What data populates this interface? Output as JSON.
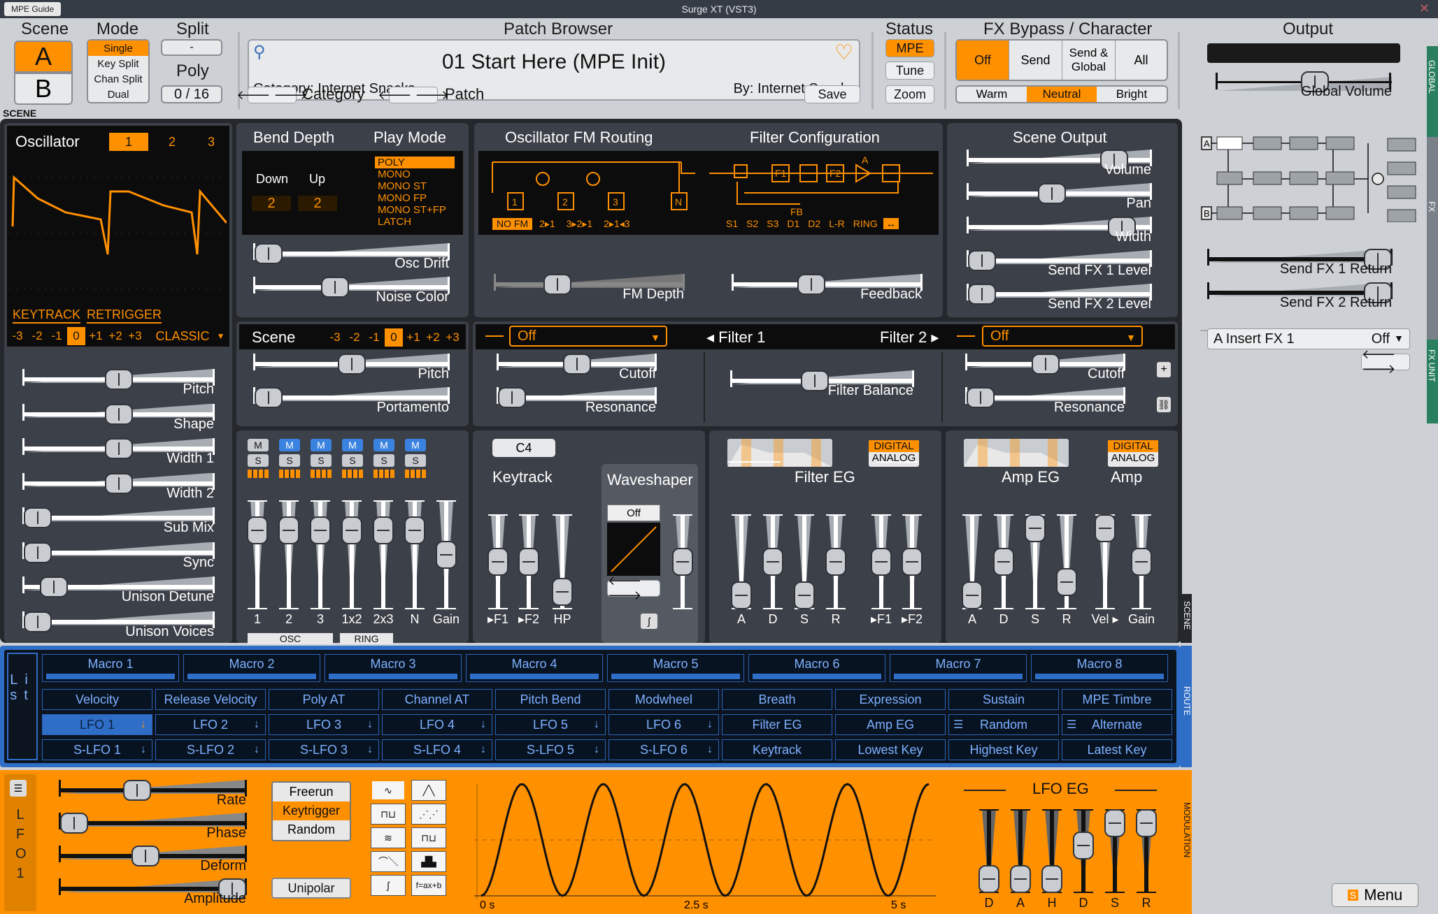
{
  "window": {
    "title": "Surge XT (VST3)",
    "guide_label": "MPE Guide"
  },
  "header": {
    "scene": {
      "label": "Scene",
      "a": "A",
      "b": "B"
    },
    "mode": {
      "label": "Mode",
      "options": [
        "Single",
        "Key Split",
        "Chan Split",
        "Dual"
      ],
      "selected": "Single"
    },
    "split": {
      "label": "Split",
      "value": "-",
      "poly_label": "Poly",
      "poly_value": "0 / 16"
    },
    "patch": {
      "label": "Patch Browser",
      "name": "01 Start Here (MPE Init)",
      "category": "Category: Internet Snacks",
      "author": "By: Internet Snacks",
      "category_label": "Category",
      "patch_label": "Patch",
      "save": "Save"
    },
    "status": {
      "label": "Status",
      "mpe": "MPE",
      "tune": "Tune",
      "zoom": "Zoom"
    },
    "fx": {
      "label": "FX Bypass / Character",
      "off": "Off",
      "send": "Send",
      "send_global": "Send & Global",
      "all": "All",
      "warm": "Warm",
      "neutral": "Neutral",
      "bright": "Bright"
    },
    "output": {
      "label": "Output",
      "global_volume": "Global Volume"
    }
  },
  "scene_tag": "SCENE",
  "oscillator": {
    "title": "Oscillator",
    "tabs": [
      "1",
      "2",
      "3"
    ],
    "keytrack": "KEYTRACK",
    "retrigger": "RETRIGGER",
    "octaves": [
      "-3",
      "-2",
      "-1",
      "0",
      "+1",
      "+2",
      "+3"
    ],
    "type": "CLASSIC",
    "params": [
      "Pitch",
      "Shape",
      "Width 1",
      "Width 2",
      "Sub Mix",
      "Sync",
      "Unison Detune",
      "Unison Voices"
    ],
    "param_levels": [
      0.5,
      0.5,
      0.5,
      0.5,
      0.0,
      0.0,
      0.1,
      0.0
    ]
  },
  "bend": {
    "title": "Bend Depth",
    "down_label": "Down",
    "up_label": "Up",
    "down": "2",
    "up": "2"
  },
  "playmode": {
    "title": "Play Mode",
    "options": [
      "POLY",
      "MONO",
      "MONO ST",
      "MONO FP",
      "MONO ST+FP",
      "LATCH"
    ],
    "selected": "POLY"
  },
  "drift": {
    "osc_drift": "Osc Drift",
    "noise_color": "Noise Color"
  },
  "fm": {
    "title": "Oscillator FM Routing",
    "modes": [
      "NO FM",
      "2▸1",
      "3▸2▸1",
      "2▸1◂3"
    ],
    "depth": "FM Depth",
    "labels": [
      "1",
      "2",
      "3",
      "N"
    ]
  },
  "filtercfg": {
    "title": "Filter Configuration",
    "modes": [
      "S1",
      "S2",
      "S3",
      "D1",
      "D2",
      "L-R",
      "RING",
      "↔"
    ],
    "feedback": "Feedback",
    "fb": "FB",
    "a": "A",
    "f1": "F1",
    "f2": "F2"
  },
  "sceneout": {
    "title": "Scene Output",
    "params": [
      "Volume",
      "Pan",
      "Width",
      "Send FX 1 Level",
      "Send FX 2 Level"
    ]
  },
  "scene2": {
    "title": "Scene",
    "octaves": [
      "-3",
      "-2",
      "-1",
      "0",
      "+1",
      "+2",
      "+3"
    ],
    "pitch": "Pitch",
    "portamento": "Portamento"
  },
  "filters": {
    "f1_type": "Off",
    "f1_label": "◂ Filter 1",
    "f2_label": "Filter 2 ▸",
    "f2_type": "Off",
    "cutoff": "Cutoff",
    "resonance": "Resonance",
    "balance": "Filter Balance"
  },
  "mixer": {
    "m": "M",
    "s": "S",
    "channels": [
      "1",
      "2",
      "3",
      "1x2",
      "2x3",
      "N",
      "Gain"
    ],
    "osc": "OSC",
    "ring": "RING",
    "mute_active": [
      false,
      true,
      true,
      true,
      true,
      true
    ]
  },
  "keytrack": {
    "note": "C4",
    "title": "Keytrack",
    "labels": [
      "▸F1",
      "▸F2",
      "HP"
    ],
    "waveshaper": "Waveshaper",
    "ws_type": "Off"
  },
  "filtereg": {
    "title": "Filter EG",
    "digital": "DIGITAL",
    "analog": "ANALOG",
    "labels": [
      "A",
      "D",
      "S",
      "R",
      "▸F1",
      "▸F2"
    ]
  },
  "ampeg": {
    "title": "Amp EG",
    "amp": "Amp",
    "digital": "DIGITAL",
    "analog": "ANALOG",
    "labels": [
      "A",
      "D",
      "S",
      "R",
      "Vel ▸",
      "Gain"
    ]
  },
  "global_side": {
    "tag_global": "GLOBAL",
    "tag_fx": "FX",
    "tag_fxunit": "FX UNIT",
    "send1": "Send FX 1 Return",
    "send2": "Send FX 2 Return",
    "insert_label": "A Insert FX 1",
    "insert_value": "Off",
    "a": "A",
    "b": "B"
  },
  "routing": {
    "list": "List",
    "macros": [
      "Macro 1",
      "Macro 2",
      "Macro 3",
      "Macro 4",
      "Macro 5",
      "Macro 6",
      "Macro 7",
      "Macro 8"
    ],
    "row1": [
      "Velocity",
      "Release Velocity",
      "Poly AT",
      "Channel AT",
      "Pitch Bend",
      "Modwheel",
      "Breath",
      "Expression",
      "Sustain",
      "MPE Timbre"
    ],
    "row2": [
      "LFO 1",
      "LFO 2",
      "LFO 3",
      "LFO 4",
      "LFO 5",
      "LFO 6",
      "Filter EG",
      "Amp EG",
      "Random",
      "Alternate"
    ],
    "row3": [
      "S-LFO 1",
      "S-LFO 2",
      "S-LFO 3",
      "S-LFO 4",
      "S-LFO 5",
      "S-LFO 6",
      "Keytrack",
      "Lowest Key",
      "Highest Key",
      "Latest Key"
    ],
    "route_tag": "ROUTE",
    "scene_tag": "SCENE"
  },
  "lfo": {
    "side": "LFO 1",
    "params": [
      "Rate",
      "Phase",
      "Deform",
      "Amplitude"
    ],
    "trigger": [
      "Freerun",
      "Keytrigger",
      "Random"
    ],
    "trigger_selected": "Keytrigger",
    "unipolar": "Unipolar",
    "time_ticks": [
      "0 s",
      "2.5 s",
      "5 s"
    ],
    "eg_title": "LFO EG",
    "eg_labels": [
      "D",
      "A",
      "H",
      "D",
      "S",
      "R"
    ],
    "formula": "f=ax+b",
    "mod_tag": "MODULATION"
  },
  "menu": "Menu",
  "colors": {
    "accent": "#ff9000",
    "panel": "#3c4048",
    "route": "#2f6ec7"
  }
}
